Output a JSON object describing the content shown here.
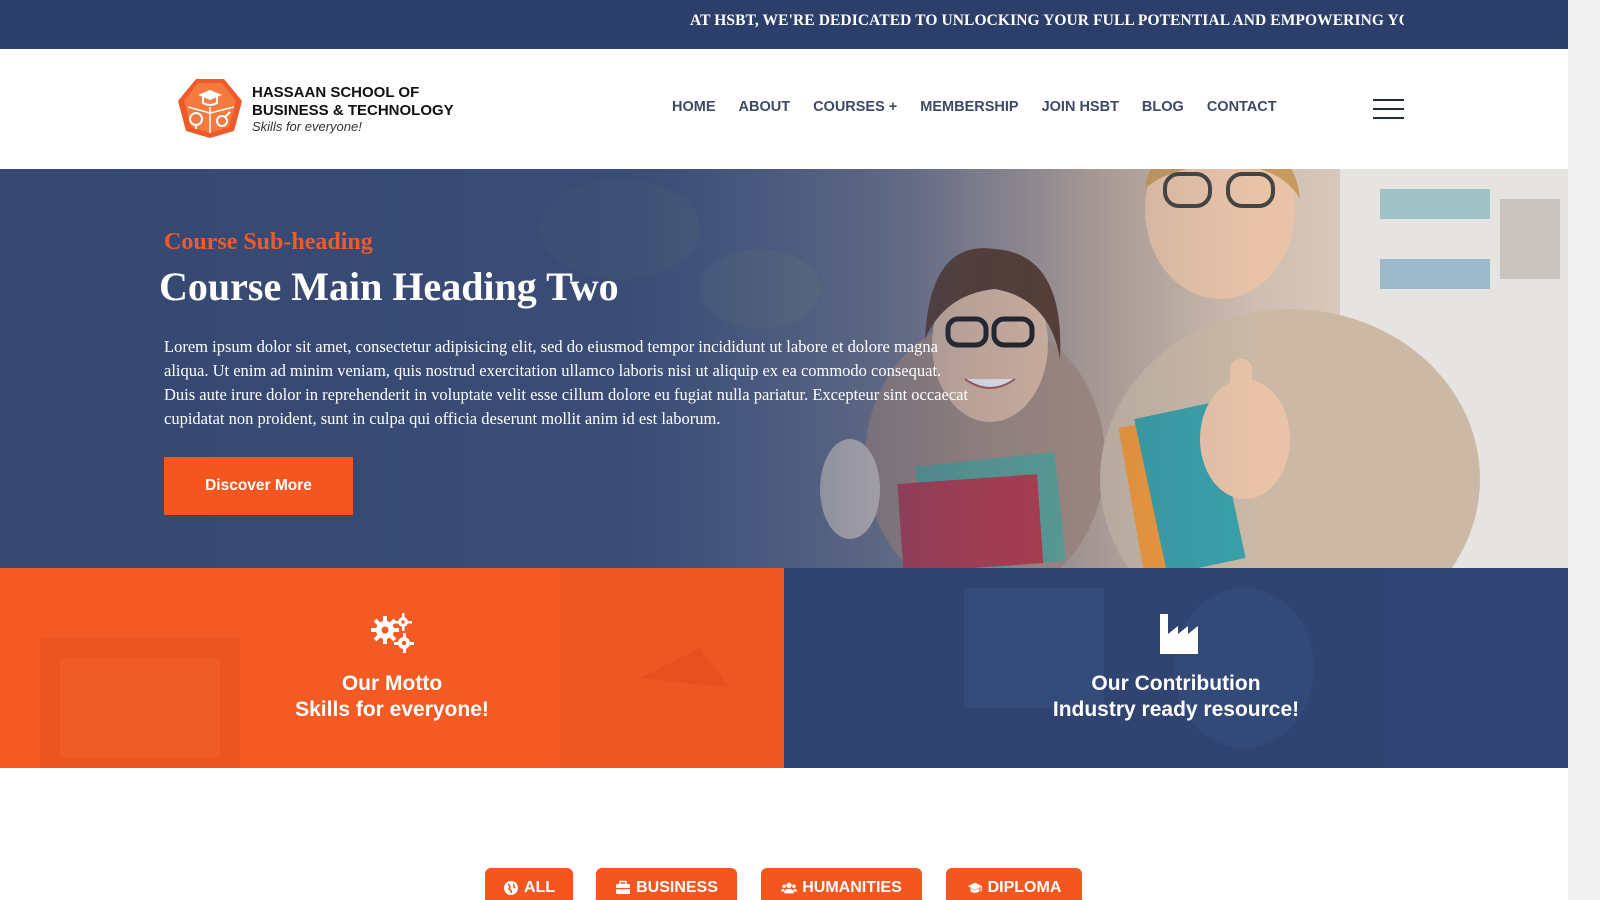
{
  "ticker": {
    "text": "AT HSBT, WE'RE DEDICATED TO UNLOCKING YOUR FULL POTENTIAL AND EMPOWERING YOU TO ACHIEVE"
  },
  "logo": {
    "line1": "HASSAAN SCHOOL OF",
    "line2": "BUSINESS & TECHNOLOGY",
    "tagline": "Skills for everyone!"
  },
  "nav": {
    "items": [
      {
        "label": "HOME",
        "icon": ""
      },
      {
        "label": "ABOUT",
        "icon": ""
      },
      {
        "label": "COURSES +",
        "icon": "plus-icon"
      },
      {
        "label": "MEMBERSHIP",
        "icon": ""
      },
      {
        "label": "JOIN HSBT",
        "icon": ""
      },
      {
        "label": "BLOG",
        "icon": ""
      },
      {
        "label": "CONTACT",
        "icon": ""
      }
    ],
    "menu_icon": "hamburger-menu-icon"
  },
  "hero": {
    "subheading": "Course Sub-heading",
    "heading": "Course Main Heading Two",
    "body": "Lorem ipsum dolor sit amet, consectetur adipisicing elit, sed do eiusmod tempor incididunt ut labore et dolore magna aliqua. Ut enim ad minim veniam, quis nostrud exercitation ullamco laboris nisi ut aliquip ex ea commodo consequat. Duis aute irure dolor in reprehenderit in voluptate velit esse cillum dolore eu fugiat nulla pariatur. Excepteur sint occaecat cupidatat non proident, sunt in culpa qui officia deserunt mollit anim id est laborum.",
    "button_label": "Discover More"
  },
  "panels": {
    "motto": {
      "icon": "gears-icon",
      "line1": "Our Motto",
      "line2": "Skills for everyone!"
    },
    "contribution": {
      "icon": "industry-icon",
      "line1": "Our Contribution",
      "line2": "Industry ready resource!"
    }
  },
  "filters": {
    "items": [
      {
        "label": "ALL",
        "icon": "globe-icon"
      },
      {
        "label": "BUSINESS",
        "icon": "briefcase-icon"
      },
      {
        "label": "HUMANITIES",
        "icon": "users-icon"
      },
      {
        "label": "DIPLOMA",
        "icon": "graduation-cap-icon"
      }
    ]
  },
  "colors": {
    "navy": "#2b3f6a",
    "accent_orange": "#f4561f",
    "nav_text": "#3d4a66"
  }
}
